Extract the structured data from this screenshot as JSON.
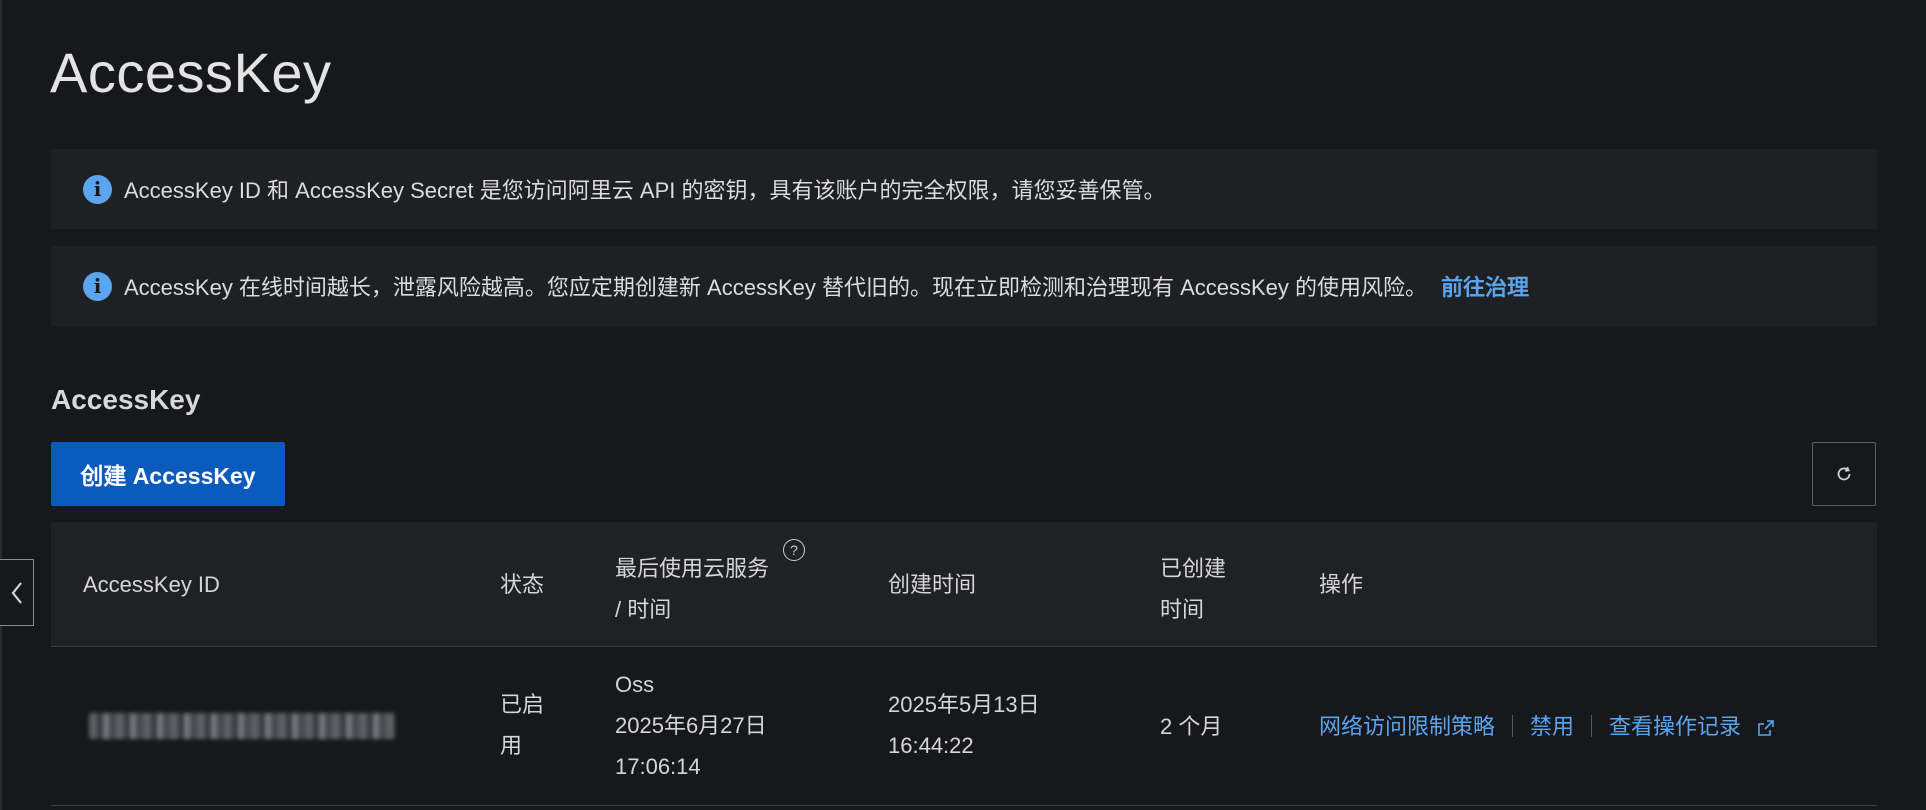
{
  "page": {
    "title": "AccessKey"
  },
  "alerts": [
    {
      "text": "AccessKey ID 和 AccessKey Secret 是您访问阿里云 API 的密钥，具有该账户的完全权限，请您妥善保管。",
      "icon": "info-icon"
    },
    {
      "text": "AccessKey 在线时间越长，泄露风险越高。您应定期创建新 AccessKey 替代旧的。现在立即检测和治理现有 AccessKey 的使用风险。",
      "link": "前往治理",
      "icon": "info-icon"
    }
  ],
  "section": {
    "title": "AccessKey"
  },
  "toolbar": {
    "create_label": "创建 AccessKey",
    "refresh_icon": "refresh-icon"
  },
  "sidebar": {
    "collapse_icon": "chevron-left-icon"
  },
  "table": {
    "headers": {
      "id": "AccessKey ID",
      "status": "状态",
      "last_used_1": "最后使用云服务",
      "last_used_2": "/ 时间",
      "created": "创建时间",
      "age_1": "已创建",
      "age_2": "时间",
      "actions": "操作"
    },
    "rows": [
      {
        "id_masked": true,
        "status_1": "已启",
        "status_2": "用",
        "last_service": "Oss",
        "last_date": "2025年6月27日",
        "last_time": "17:06:14",
        "created_date": "2025年5月13日",
        "created_time": "16:44:22",
        "age": "2 个月",
        "actions": [
          "网络访问限制策略",
          "禁用",
          "查看操作记录"
        ]
      }
    ]
  },
  "colors": {
    "background": "#17181c",
    "panel": "#1e2024",
    "accent": "#5aa5ee",
    "primary_button": "#0b5bbf"
  }
}
